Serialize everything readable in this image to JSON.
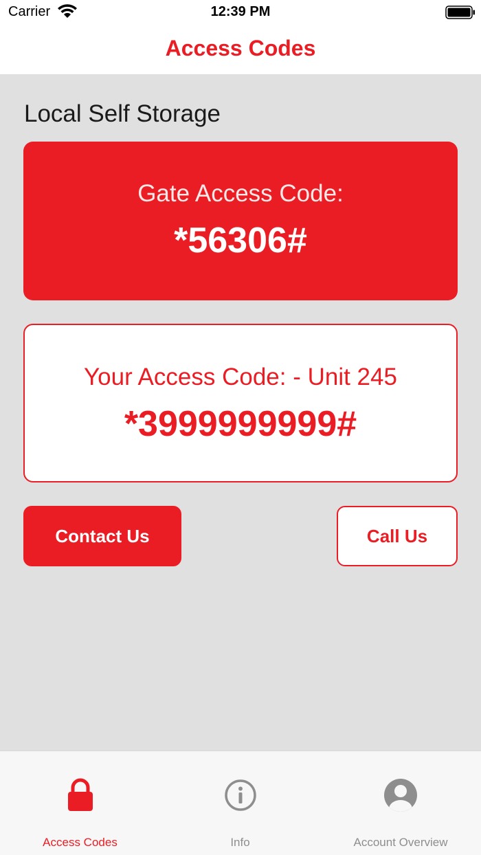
{
  "status_bar": {
    "carrier": "Carrier",
    "time": "12:39 PM"
  },
  "nav": {
    "title": "Access Codes"
  },
  "main": {
    "facility_name": "Local Self Storage",
    "gate_card": {
      "label": "Gate Access Code:",
      "code": "*56306#"
    },
    "unit_card": {
      "label": "Your Access Code: - Unit 245",
      "code": "*3999999999#"
    },
    "buttons": {
      "contact_label": "Contact Us",
      "call_label": "Call Us"
    }
  },
  "tab_bar": {
    "tabs": [
      {
        "label": "Access Codes",
        "icon": "lock-icon",
        "active": true
      },
      {
        "label": "Info",
        "icon": "info-icon",
        "active": false
      },
      {
        "label": "Account Overview",
        "icon": "account-icon",
        "active": false
      }
    ]
  },
  "colors": {
    "accent": "#ea1c24",
    "background": "#e0e0e0",
    "inactive": "#8e8e8e"
  }
}
